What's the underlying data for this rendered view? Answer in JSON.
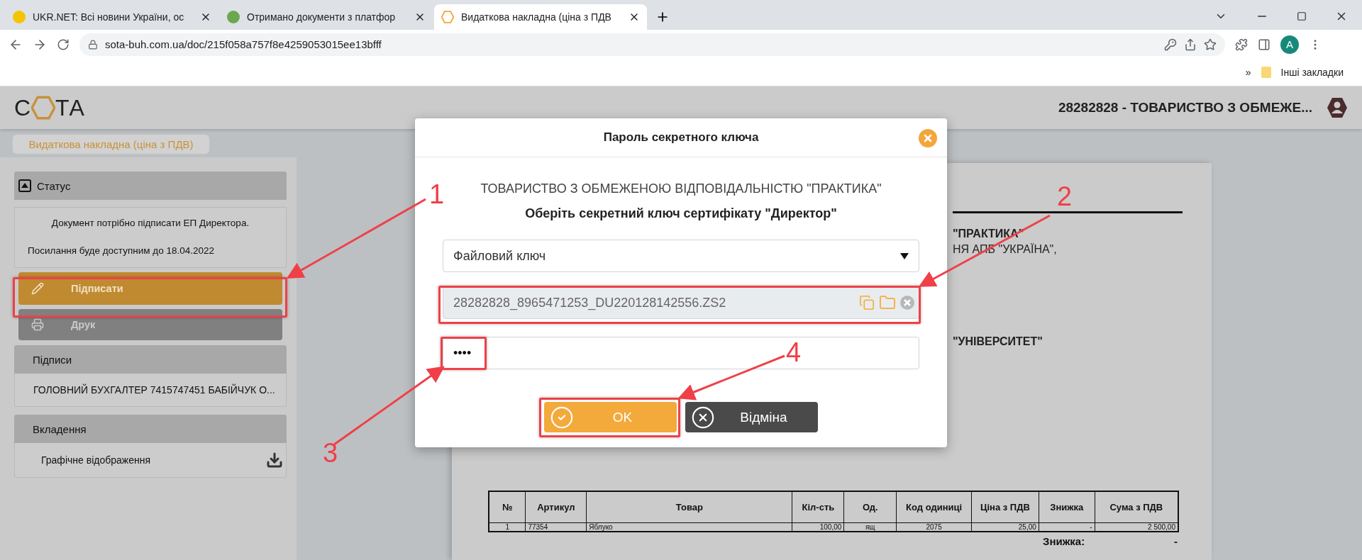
{
  "browser": {
    "tabs": [
      {
        "title": "UKR.NET: Всі новини України, ос",
        "selected": false
      },
      {
        "title": "Отримано документи з платфор",
        "selected": false
      },
      {
        "title": "Видаткова накладна (ціна з ПДВ",
        "selected": true
      }
    ],
    "address": "sota-buh.com.ua/doc/215f058a757f8e4259053015ee13bfff",
    "bookmarks_overflow": "»",
    "bookmarks_folder": "Інші закладки",
    "profile": "A"
  },
  "header": {
    "logo_start": "С",
    "logo_end": "ТА",
    "company": "28282828 - ТОВАРИСТВО З ОБМЕЖЕ..."
  },
  "document_tab": "Видаткова накладна (ціна з ПДВ)",
  "sidebar": {
    "status": {
      "title": "Статус",
      "expanded": true,
      "message": "Документ потрібно підписати ЕП Директора.",
      "link_note": "Посилання буде доступним до 18.04.2022"
    },
    "actions": [
      {
        "kind": "sign",
        "label": "Підписати"
      },
      {
        "kind": "print",
        "label": "Друк"
      }
    ],
    "signatures": {
      "title": "Підписи",
      "items": [
        "ГОЛОВНИЙ БУХГАЛТЕР 7415747451 БАБІЙЧУК О..."
      ]
    },
    "attachments": {
      "title": "Вкладення",
      "items": [
        "Графічне відображення"
      ]
    }
  },
  "document": {
    "lines": [
      {
        "text": "\"ПРАКТИКА\"",
        "bold": true
      },
      {
        "text": "НЯ АПБ \"УКРАЇНА\",",
        "bold": false
      },
      {
        "text": "\"УНІВЕРСИТЕТ\"",
        "bold": true
      }
    ],
    "table": {
      "columns": [
        "№",
        "Артикул",
        "Товар",
        "Кіл-сть",
        "Од.",
        "Код одиниці",
        "Ціна з ПДВ",
        "Знижка",
        "Сума з ПДВ"
      ],
      "rows": [
        [
          "1",
          "77354",
          "Яблуко",
          "100,00",
          "ящ",
          "2075",
          "25,00",
          "-",
          "2 500,00"
        ]
      ]
    },
    "discount_label": "Знижка:",
    "discount_value": "-"
  },
  "dialog": {
    "title": "Пароль секретного ключа",
    "company": "ТОВАРИСТВО З ОБМЕЖЕНОЮ ВІДПОВІДАЛЬНІСТЮ \"ПРАКТИКА\"",
    "prompt": "Оберіть секретний ключ сертифікату \"Директор\"",
    "key_type": "Файловий ключ",
    "key_file": "28282828_8965471253_DU220128142556.ZS2",
    "password": "••••",
    "buttons": [
      {
        "kind": "ok",
        "label": "OK"
      },
      {
        "kind": "cancel",
        "label": "Відміна"
      }
    ]
  },
  "annotations": [
    {
      "label": "1"
    },
    {
      "label": "2"
    },
    {
      "label": "3"
    },
    {
      "label": "4"
    }
  ]
}
